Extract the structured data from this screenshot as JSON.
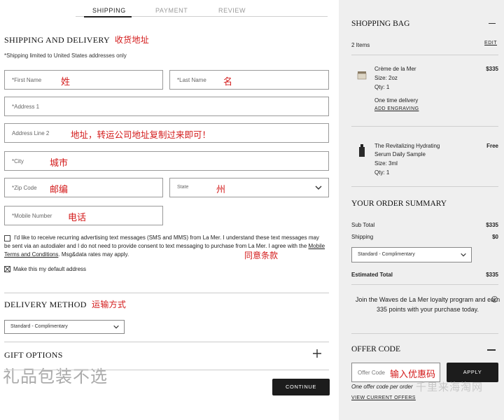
{
  "tabs": [
    "SHIPPING",
    "PAYMENT",
    "REVIEW"
  ],
  "shipping": {
    "title": "SHIPPING AND DELIVERY",
    "title_cn": "收货地址",
    "note": "*Shipping limited to United States addresses only",
    "first_name": {
      "placeholder": "*First Name",
      "cn": "姓"
    },
    "last_name": {
      "placeholder": "*Last Name",
      "cn": "名"
    },
    "address1": {
      "placeholder": "*Address 1"
    },
    "address2": {
      "placeholder": "Address Line 2",
      "cn": "地址，转运公司地址复制过来即可！"
    },
    "city": {
      "placeholder": "*City",
      "cn": "城市"
    },
    "zip": {
      "placeholder": "*Zip Code",
      "cn": "邮编"
    },
    "state": {
      "placeholder": "State",
      "cn": "州"
    },
    "mobile": {
      "placeholder": "*Mobile Number",
      "cn": "电话"
    },
    "consent_part1": "I'd like to receive recurring advertising text messages (SMS and MMS) from La Mer. I understand these text messages may be sent via an autodialer and I do not need to provide consent to text messaging to purchase from La Mer. I agree with the ",
    "consent_link": "Mobile Terms and Conditions",
    "consent_part2": ". Msg&data rates may apply.",
    "consent_cn": "同意条款",
    "default_address": "Make this my default address"
  },
  "delivery": {
    "title": "DELIVERY METHOD",
    "title_cn": "运输方式",
    "selected": "Standard - Complimentary"
  },
  "gift": {
    "title": "GIFT OPTIONS",
    "cn": "礼品包装不选"
  },
  "continue_label": "CONTINUE",
  "bag": {
    "title": "SHOPPING BAG",
    "count": "2 Items",
    "edit": "EDIT",
    "items": [
      {
        "name": "Crème de la Mer",
        "size": "Size: 2oz",
        "qty": "Qty: 1",
        "price": "$335",
        "delivery": "One time delivery",
        "engraving": "ADD ENGRAVING"
      },
      {
        "name_line1": "The Revitalizing Hydrating",
        "name_line2": "Serum Daily Sample",
        "size": "Size: 3ml",
        "qty": "Qty: 1",
        "price": "Free"
      }
    ]
  },
  "summary": {
    "title": "YOUR ORDER SUMMARY",
    "subtotal_label": "Sub Total",
    "subtotal": "$335",
    "shipping_label": "Shipping",
    "shipping": "$0",
    "shipping_select": "Standard - Complimentary",
    "estimated_label": "Estimated Total",
    "estimated": "$335",
    "loyalty": "Join the Waves de La Mer loyalty program and earn 335 points with your purchase today."
  },
  "offer": {
    "title": "OFFER CODE",
    "placeholder": "Offer Code",
    "cn": "输入优惠码",
    "apply": "APPLY",
    "note": "One offer code per order",
    "view": "VIEW CURRENT OFFERS"
  },
  "watermark": "千里来海淘网"
}
